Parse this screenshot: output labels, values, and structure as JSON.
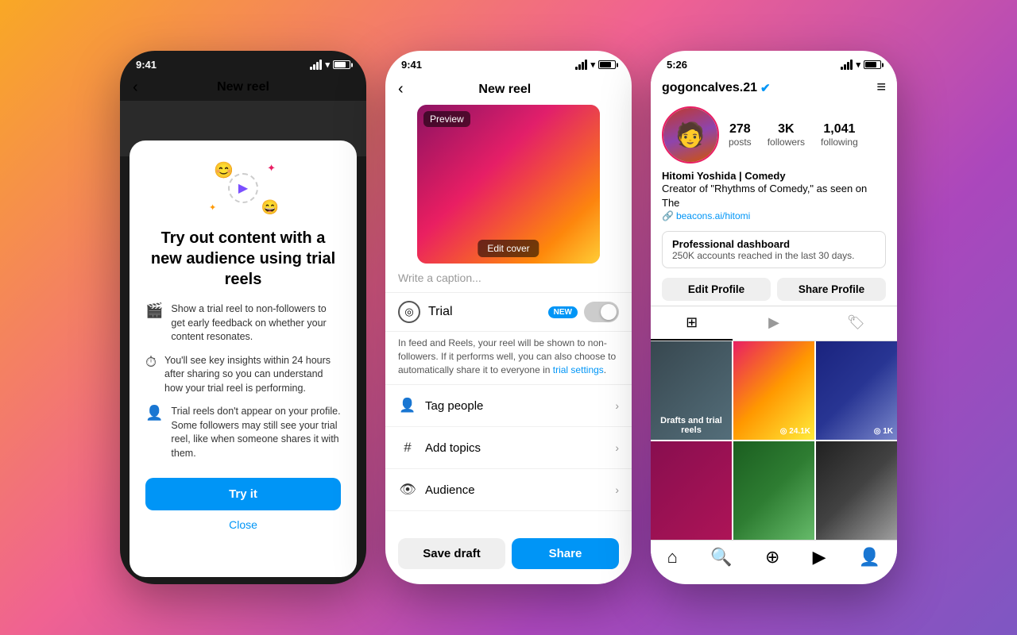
{
  "background": {
    "gradient": "linear-gradient(135deg, #f9a825 0%, #f06292 40%, #ab47bc 70%, #7e57c2 100%)"
  },
  "phone1": {
    "status_time": "9:41",
    "header_title": "New reel",
    "back_label": "‹",
    "trial_title": "Try out content with a new audience using trial reels",
    "point1": "Show a trial reel to non-followers to get early feedback on whether your content resonates.",
    "point2": "You'll see key insights within 24 hours after sharing so you can understand how your trial reel is performing.",
    "point3": "Trial reels don't appear on your profile. Some followers may still see your trial reel, like when someone shares it with them.",
    "try_btn": "Try it",
    "close_link": "Close"
  },
  "phone2": {
    "status_time": "9:41",
    "header_title": "New reel",
    "back_label": "‹",
    "preview_label": "Preview",
    "edit_cover_label": "Edit cover",
    "caption_placeholder": "Write a caption...",
    "trial_label": "Trial",
    "new_badge": "NEW",
    "trial_desc": "In feed and Reels, your reel will be shown to non-followers. If it performs well, you can also choose to automatically share it to everyone in ",
    "trial_link": "trial settings",
    "tag_people": "Tag people",
    "add_topics": "Add topics",
    "audience": "Audience",
    "save_draft": "Save draft",
    "share": "Share"
  },
  "phone3": {
    "status_time": "5:26",
    "username": "gogoncalves.21",
    "verified": "●",
    "posts_count": "278",
    "posts_label": "posts",
    "followers_count": "3K",
    "followers_label": "followers",
    "following_count": "1,041",
    "following_label": "following",
    "bio_name": "Hitomi Yoshida | Comedy",
    "bio_line2": "Creator of \"Rhythms of Comedy,\" as seen on The",
    "bio_link": "beacons.ai/hitomi",
    "dashboard_title": "Professional dashboard",
    "dashboard_sub": "250K accounts reached in the last 30 days.",
    "edit_profile": "Edit Profile",
    "share_profile": "Share Profile",
    "drafts_label": "Drafts and trial reels",
    "count1": "◎ 24.1K",
    "count2": "◎ 1K"
  }
}
